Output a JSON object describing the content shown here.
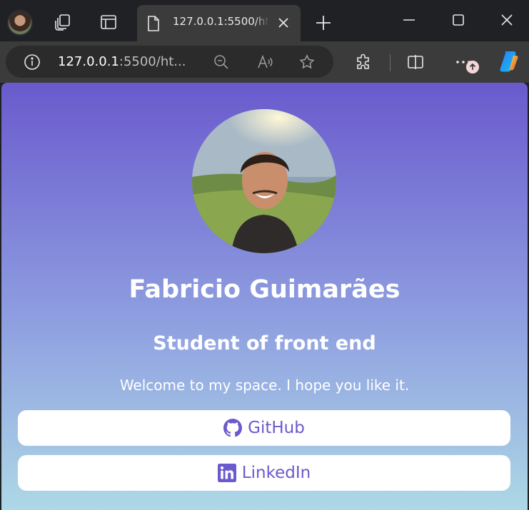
{
  "browser": {
    "tab_title": "127.0.0.1:5500/html",
    "address_host": "127.0.0.1",
    "address_rest": ":5500/ht...",
    "colors": {
      "chrome_dark": "#202124",
      "toolbar": "#3b3b3b",
      "omnibox": "#2b2b2b"
    },
    "icons": [
      "profile-avatar",
      "workspaces-icon",
      "vertical-tabs-icon",
      "page-icon",
      "close-icon",
      "new-tab-icon",
      "minimize-icon",
      "maximize-icon",
      "close-window-icon",
      "site-info-icon",
      "zoom-out-icon",
      "read-aloud-icon",
      "favorite-star-icon",
      "extensions-icon",
      "split-screen-icon",
      "more-icon",
      "copilot-icon"
    ]
  },
  "page": {
    "name": "Fabricio Guimarães",
    "role": "Student of front end",
    "welcome": "Welcome to my space. I hope you like it.",
    "links": [
      {
        "label": "GitHub",
        "icon": "github-icon"
      },
      {
        "label": "LinkedIn",
        "icon": "linkedin-icon"
      }
    ],
    "colors": {
      "gradient_top": "#6a5acd",
      "gradient_bottom": "#add8e6",
      "accent": "#6a5acd",
      "button_bg": "#ffffff"
    }
  }
}
